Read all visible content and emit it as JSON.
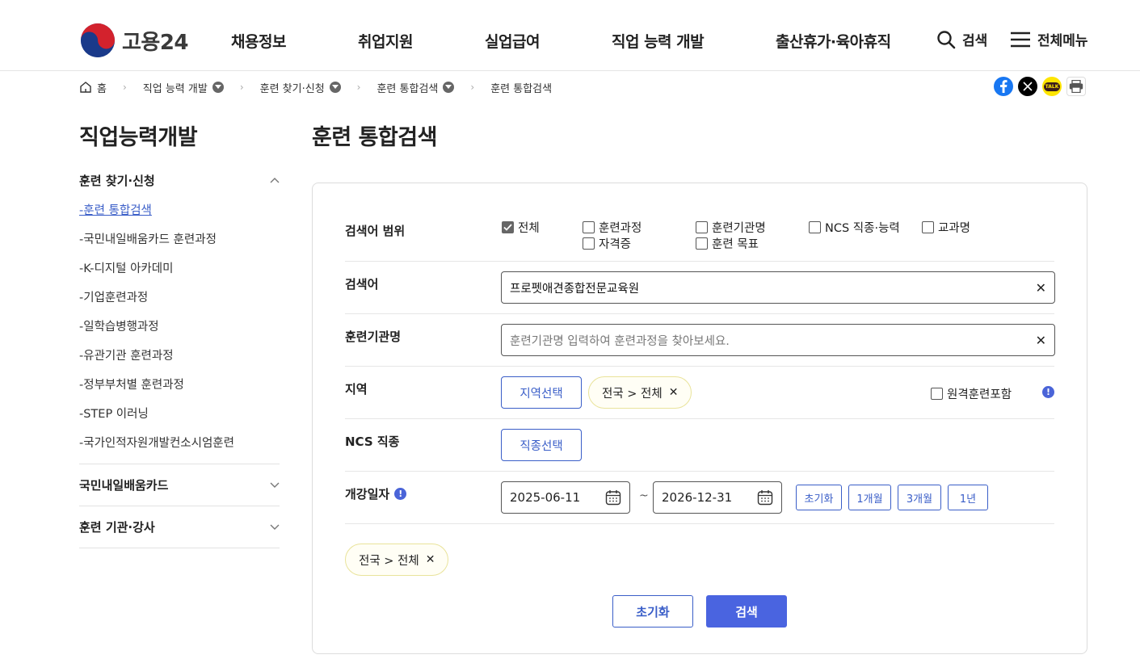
{
  "header": {
    "logo_text": "고용24",
    "nav": [
      "채용정보",
      "취업지원",
      "실업급여",
      "직업 능력 개발",
      "출산휴가·육아휴직"
    ],
    "search_label": "검색",
    "menu_label": "전체메뉴"
  },
  "breadcrumb": {
    "home": "홈",
    "items": [
      "직업 능력 개발",
      "훈련 찾기·신청",
      "훈련 통합검색",
      "훈련 통합검색"
    ]
  },
  "share": {
    "kakao_label": "TALK"
  },
  "sidebar": {
    "title": "직업능력개발",
    "group_open": "훈련 찾기·신청",
    "items": [
      "-훈련 통합검색",
      "-국민내일배움카드 훈련과정",
      "-K-디지털 아카데미",
      "-기업훈련과정",
      "-일학습병행과정",
      "-유관기관 훈련과정",
      "-정부부처별 훈련과정",
      "-STEP 이러닝",
      "-국가인적자원개발컨소시엄훈련"
    ],
    "group_2": "국민내일배움카드",
    "group_3": "훈련 기관·강사"
  },
  "main": {
    "title": "훈련 통합검색",
    "scope": {
      "label": "검색어 범위",
      "options": [
        "전체",
        "훈련과정",
        "훈련기관명",
        "NCS 직종·능력",
        "교과명",
        "자격증",
        "훈련 목표"
      ]
    },
    "keyword": {
      "label": "검색어",
      "value": "프로펫애견종합전문교육원"
    },
    "institution": {
      "label": "훈련기관명",
      "placeholder": "훈련기관명 입력하여 훈련과정을 찾아보세요."
    },
    "region": {
      "label": "지역",
      "button": "지역선택",
      "chip": "전국 > 전체",
      "remote": "원격훈련포함"
    },
    "ncs": {
      "label": "NCS 직종",
      "button": "직종선택"
    },
    "date": {
      "label": "개강일자",
      "start": "2025-06-11",
      "tilde": "~",
      "end": "2026-12-31",
      "quick": [
        "초기화",
        "1개월",
        "3개월",
        "1년"
      ]
    },
    "selected_chip": "전국 > 전체",
    "reset_button": "초기화",
    "search_button": "검색"
  },
  "colors": {
    "accent": "#3a5ec8",
    "primary_button": "#4a64e0",
    "chip_border": "#e9e39a"
  }
}
